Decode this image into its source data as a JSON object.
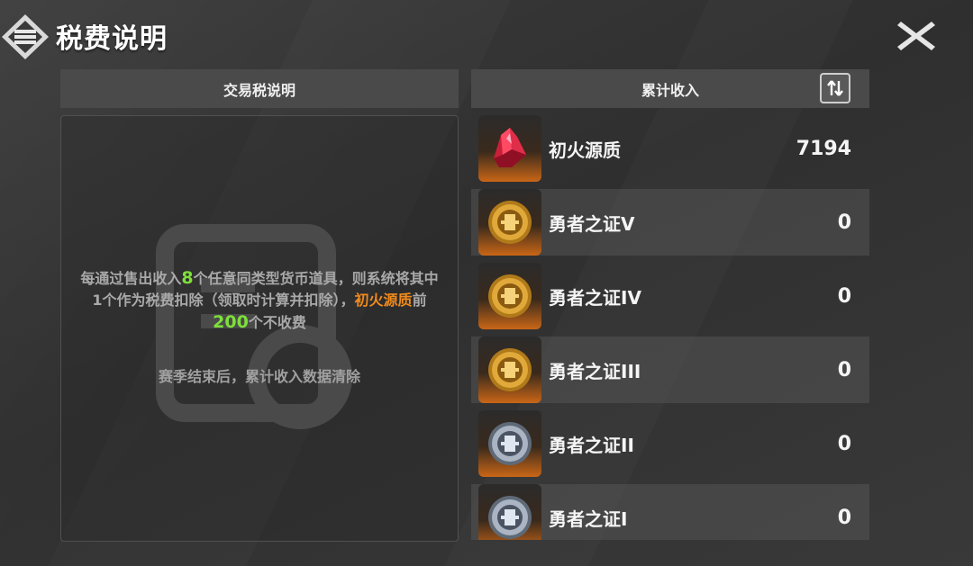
{
  "header": {
    "title": "税费说明"
  },
  "left_panel": {
    "header": "交易税说明",
    "desc_part1": "每通过售出收入",
    "desc_num1": "8",
    "desc_part2": "个任意同类型货币道具，则系统将其中1个作为税费扣除（领取时计算并扣除），",
    "desc_item": "初火源质",
    "desc_part3": "前",
    "desc_num2": "200",
    "desc_part4": "个不收费",
    "note": "赛季结束后，累计收入数据清除"
  },
  "right_panel": {
    "header": "累计收入",
    "items": [
      {
        "name": "初火源质",
        "count": "7194",
        "icon": "red-crystal-icon"
      },
      {
        "name": "勇者之证V",
        "count": "0",
        "icon": "gold-medal-icon"
      },
      {
        "name": "勇者之证IV",
        "count": "0",
        "icon": "gold-medal-icon"
      },
      {
        "name": "勇者之证III",
        "count": "0",
        "icon": "gold-medal-icon"
      },
      {
        "name": "勇者之证II",
        "count": "0",
        "icon": "silver-medal-icon"
      },
      {
        "name": "勇者之证I",
        "count": "0",
        "icon": "silver-medal-icon"
      }
    ]
  },
  "colors": {
    "highlight_green": "#7de03a",
    "highlight_orange": "#f08a1c",
    "icon_orange": "#c96617"
  }
}
